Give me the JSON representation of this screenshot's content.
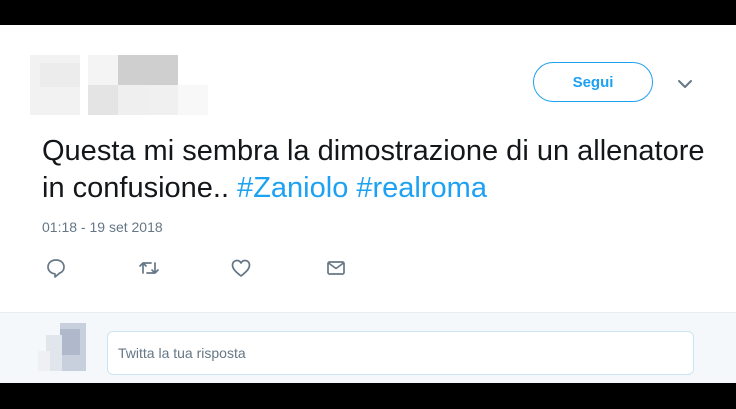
{
  "header": {
    "follow_label": "Segui",
    "menu_icon": "chevron-down-icon"
  },
  "tweet": {
    "text_plain": "Questa mi sembra la dimostrazione di un allenatore in confusione..",
    "hashtags": [
      "#Zaniolo",
      "#realroma"
    ],
    "timestamp": "01:18 - 19 set 2018"
  },
  "actions": [
    "reply-icon",
    "retweet-icon",
    "like-icon",
    "direct-message-icon"
  ],
  "reply": {
    "placeholder": "Twitta la tua risposta"
  },
  "colors": {
    "accent": "#1da1f2",
    "text": "#14171a",
    "muted": "#657786"
  }
}
